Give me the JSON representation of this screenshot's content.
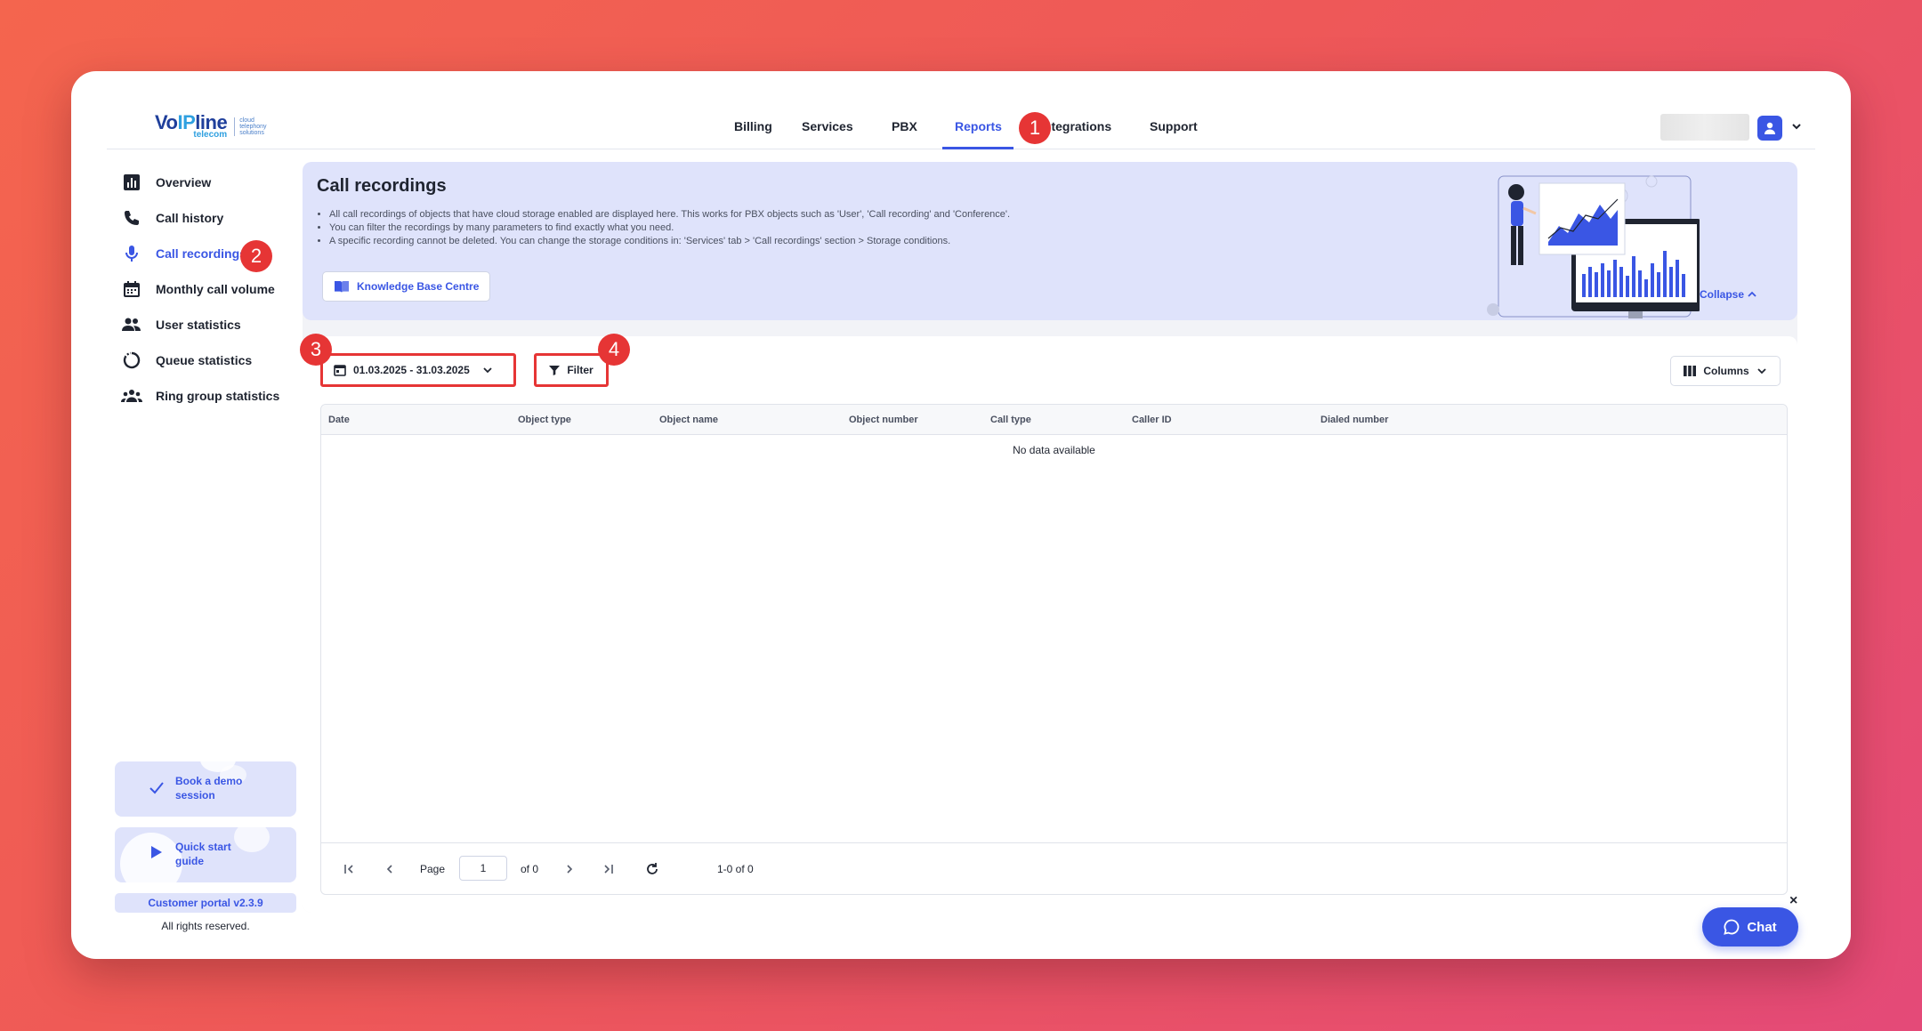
{
  "brand": {
    "logo_main_pre": "Vo",
    "logo_main_ip": "IP",
    "logo_main_post": "line",
    "logo_sub": "telecom",
    "logo_tag": [
      "cloud",
      "telephony",
      "solutions"
    ],
    "accent": "#3a56e4",
    "highlight": "#e63535"
  },
  "nav": {
    "items": [
      {
        "label": "Billing",
        "active": false
      },
      {
        "label": "Services",
        "active": false
      },
      {
        "label": "PBX",
        "active": false
      },
      {
        "label": "Reports",
        "active": true
      },
      {
        "label": "Integrations",
        "active": false
      },
      {
        "label": "Support",
        "active": false
      }
    ]
  },
  "sidebar": {
    "items": [
      {
        "label": "Overview",
        "icon": "bar-chart-icon",
        "active": false
      },
      {
        "label": "Call history",
        "icon": "phone-icon",
        "active": false
      },
      {
        "label": "Call recordings",
        "icon": "microphone-icon",
        "active": true
      },
      {
        "label": "Monthly call volume",
        "icon": "calendar-icon",
        "active": false
      },
      {
        "label": "User statistics",
        "icon": "users-icon",
        "active": false
      },
      {
        "label": "Queue statistics",
        "icon": "queue-icon",
        "active": false
      },
      {
        "label": "Ring group statistics",
        "icon": "group-icon",
        "active": false
      }
    ],
    "demo": {
      "line1": "Book a demo",
      "line2": "session"
    },
    "guide": {
      "line1": "Quick start",
      "line2": "guide"
    },
    "version": "Customer portal v2.3.9",
    "rights": "All rights reserved."
  },
  "banner": {
    "title": "Call recordings",
    "bullets": [
      "All call recordings of objects that have cloud storage enabled are displayed here. This works for PBX objects such as 'User', 'Call recording' and 'Conference'.",
      "You can filter the recordings by many parameters to find exactly what you need.",
      "A specific recording cannot be deleted. You can change the storage conditions in: 'Services' tab > 'Call recordings' section > Storage conditions."
    ],
    "kb_button": "Knowledge Base Centre",
    "collapse": "Collapse"
  },
  "toolbar": {
    "date_range": "01.03.2025 - 31.03.2025",
    "filter": "Filter",
    "columns": "Columns"
  },
  "table": {
    "columns": [
      "Date",
      "Object type",
      "Object name",
      "Object number",
      "Call type",
      "Caller ID",
      "Dialed number"
    ],
    "empty_text": "No data available"
  },
  "pager": {
    "page_label": "Page",
    "page_value": "1",
    "of_label": "of 0",
    "range": "1-0 of 0"
  },
  "badges": [
    "1",
    "2",
    "3",
    "4"
  ],
  "chat": {
    "label": "Chat",
    "close": "×"
  }
}
